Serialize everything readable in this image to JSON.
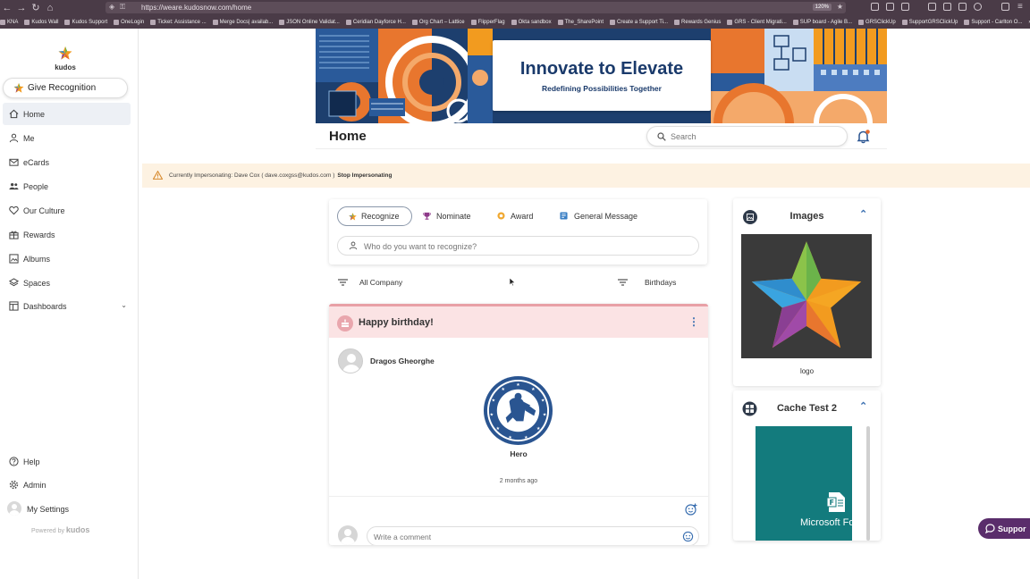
{
  "browser": {
    "url": "https://weare.kudosnow.com/home",
    "zoom": "120%",
    "bookmarks": [
      "KNA",
      "Kudos Wall",
      "Kudos Support",
      "OneLogin",
      "Ticket: Assistance ...",
      "Merge Docs| availab...",
      "JSON Online Validat...",
      "Ceridian Dayforce H...",
      "Org Chart – Lattice",
      "FlipperFlag",
      "Okta sandbox",
      "The_SharePoint",
      "Create a Support Ti...",
      "Rewards Genius",
      "GRS - Client Migrati...",
      "SUP board - Agile B...",
      "GRSClickUp",
      "SupportGRSClickUp",
      "Support - Carlton O..."
    ],
    "bookmarks_overflow": "Othe"
  },
  "sidebar": {
    "logo_text": "kudos",
    "give_button": "Give Recognition",
    "items": [
      {
        "label": "Home",
        "icon": "home-icon"
      },
      {
        "label": "Me",
        "icon": "person-icon"
      },
      {
        "label": "eCards",
        "icon": "mail-icon"
      },
      {
        "label": "People",
        "icon": "people-icon"
      },
      {
        "label": "Our Culture",
        "icon": "heart-icon"
      },
      {
        "label": "Rewards",
        "icon": "gift-icon"
      },
      {
        "label": "Albums",
        "icon": "album-icon"
      },
      {
        "label": "Spaces",
        "icon": "layers-icon"
      },
      {
        "label": "Dashboards",
        "icon": "dashboard-icon"
      }
    ],
    "bottom_items": [
      {
        "label": "Help",
        "icon": "help-icon"
      },
      {
        "label": "Admin",
        "icon": "gear-icon"
      },
      {
        "label": "My Settings",
        "icon": "avatar"
      }
    ],
    "powered_by": "Powered by",
    "powered_brand": "kudos"
  },
  "banner": {
    "title": "Innovate to Elevate",
    "subtitle": "Redefining Possibilities Together"
  },
  "header": {
    "page_title": "Home",
    "search_placeholder": "Search"
  },
  "impersonation": {
    "text": "Currently Impersonating: Dave Cox ( dave.coxgss@kudos.com )",
    "action": "Stop Impersonating"
  },
  "compose": {
    "tabs": [
      {
        "label": "Recognize",
        "icon": "star-icon",
        "color": "#e8b13a"
      },
      {
        "label": "Nominate",
        "icon": "trophy-icon",
        "color": "#8e3a8a"
      },
      {
        "label": "Award",
        "icon": "award-icon",
        "color": "#f0a830"
      },
      {
        "label": "General Message",
        "icon": "message-icon",
        "color": "#3a7fc4"
      }
    ],
    "who_placeholder": "Who do you want to recognize?"
  },
  "filters": {
    "left": "All Company",
    "right": "Birthdays"
  },
  "post": {
    "title": "Happy birthday!",
    "author": "Dragos Gheorghe",
    "badge": "Hero",
    "time": "2 months ago",
    "comment_placeholder": "Write a comment"
  },
  "right_cards": {
    "images_title": "Images",
    "image_caption": "logo",
    "cache_title": "Cache Test 2",
    "doc_label": "Microsoft Fo"
  },
  "support_label": "Suppor",
  "colors": {
    "accent": "#4a6fa5",
    "birthday_header": "#fbe3e4",
    "impersonation_bg": "#fdf2e2",
    "support_bg": "#5a2d6b",
    "doc_teal": "#137b7d"
  }
}
